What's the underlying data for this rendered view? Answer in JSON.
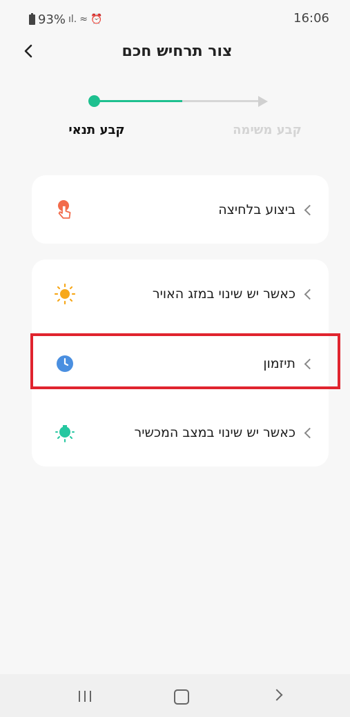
{
  "status_bar": {
    "battery": "93%",
    "time": "16:06"
  },
  "header": {
    "title": "צור תרחיש חכם"
  },
  "stepper": {
    "step1_label": "קבע תנאי",
    "step2_label": "קבע משימה"
  },
  "conditions": {
    "tap_to_run": {
      "label": "ביצוע בלחיצה",
      "icon": "hand-tap-icon"
    },
    "weather_change": {
      "label": "כאשר יש שינוי במזג האויר",
      "icon": "sun-icon"
    },
    "schedule": {
      "label": "תיזמון",
      "icon": "clock-icon"
    },
    "device_change": {
      "label": "כאשר יש שינוי במצב המכשיר",
      "icon": "bulb-icon"
    }
  },
  "colors": {
    "accent": "#1ec08f",
    "highlight": "#e0242e",
    "tap": "#f26b4b",
    "sun": "#f7a81b",
    "clock": "#4a8fe0",
    "bulb": "#25c7a0"
  }
}
